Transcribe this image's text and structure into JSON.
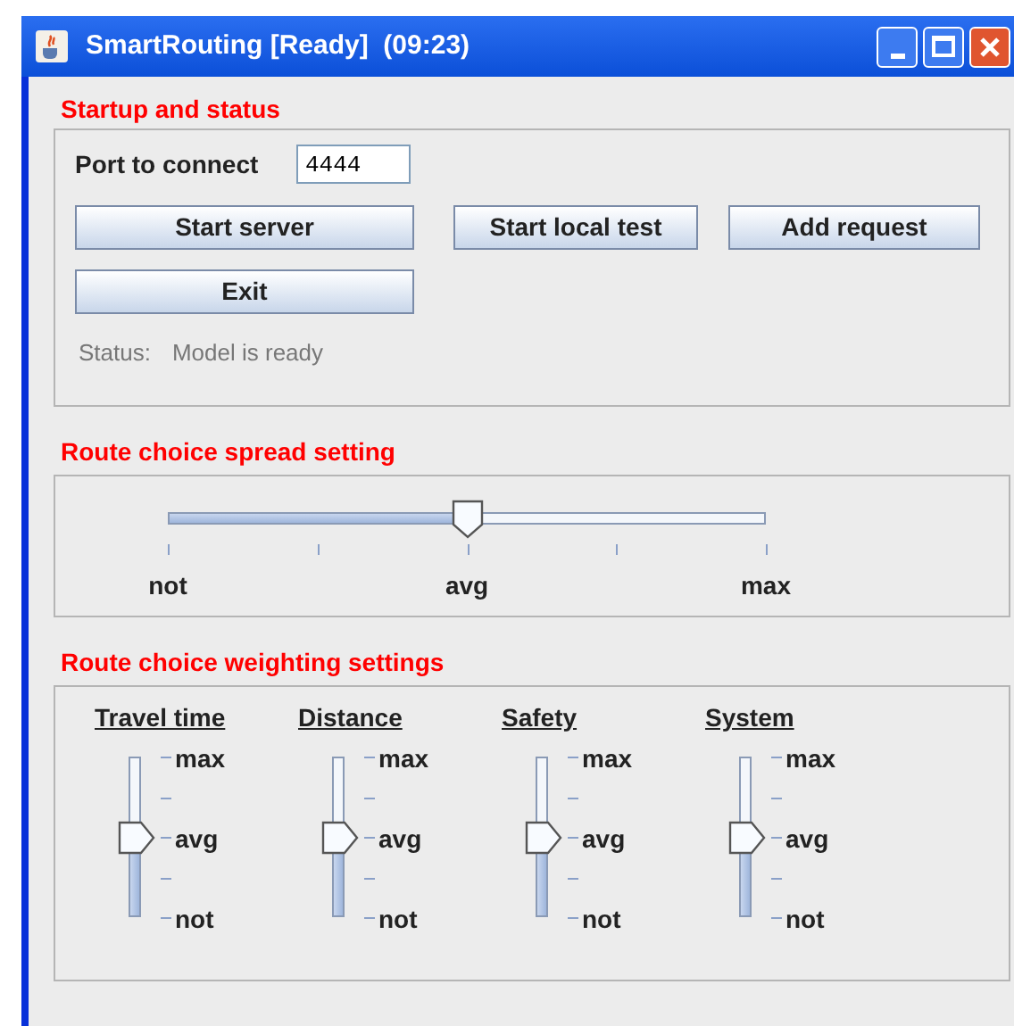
{
  "window": {
    "title": "SmartRouting [Ready]  (09:23)"
  },
  "startup": {
    "heading": "Startup and status",
    "port_label": "Port to connect",
    "port_value": "4444",
    "buttons": [
      "Start server",
      "Start local test",
      "Add request",
      "Exit"
    ],
    "status_label": "Status:",
    "status_text": "Model is ready"
  },
  "spread": {
    "heading": "Route choice spread setting",
    "level": 0.5,
    "labels": [
      "not",
      "avg",
      "max"
    ]
  },
  "weighting": {
    "heading": "Route choice weighting settings",
    "sliders": [
      {
        "title": "Travel time",
        "level": 0.5,
        "labels": [
          "max",
          "avg",
          "not"
        ]
      },
      {
        "title": "Distance",
        "level": 0.5,
        "labels": [
          "max",
          "avg",
          "not"
        ]
      },
      {
        "title": "Safety",
        "level": 0.5,
        "labels": [
          "max",
          "avg",
          "not"
        ]
      },
      {
        "title": "System",
        "level": 0.5,
        "labels": [
          "max",
          "avg",
          "not"
        ]
      }
    ]
  }
}
